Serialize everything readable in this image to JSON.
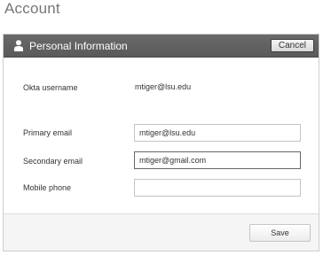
{
  "page": {
    "title": "Account"
  },
  "panel": {
    "header": {
      "icon": "person-icon",
      "title": "Personal Information",
      "cancel_label": "Cancel"
    },
    "fields": {
      "okta_username": {
        "label": "Okta username",
        "value": "mtiger@lsu.edu"
      },
      "primary_email": {
        "label": "Primary email",
        "value": "mtiger@lsu.edu",
        "placeholder": ""
      },
      "secondary_email": {
        "label": "Secondary email",
        "value": "mtiger@gmail.com",
        "placeholder": ""
      },
      "mobile_phone": {
        "label": "Mobile phone",
        "value": "",
        "placeholder": ""
      }
    },
    "footer": {
      "save_label": "Save"
    }
  },
  "colors": {
    "header_bg": "#5f5f5f",
    "header_text": "#ffffff",
    "footer_bg": "#f5f5f5",
    "page_title": "#777777"
  }
}
